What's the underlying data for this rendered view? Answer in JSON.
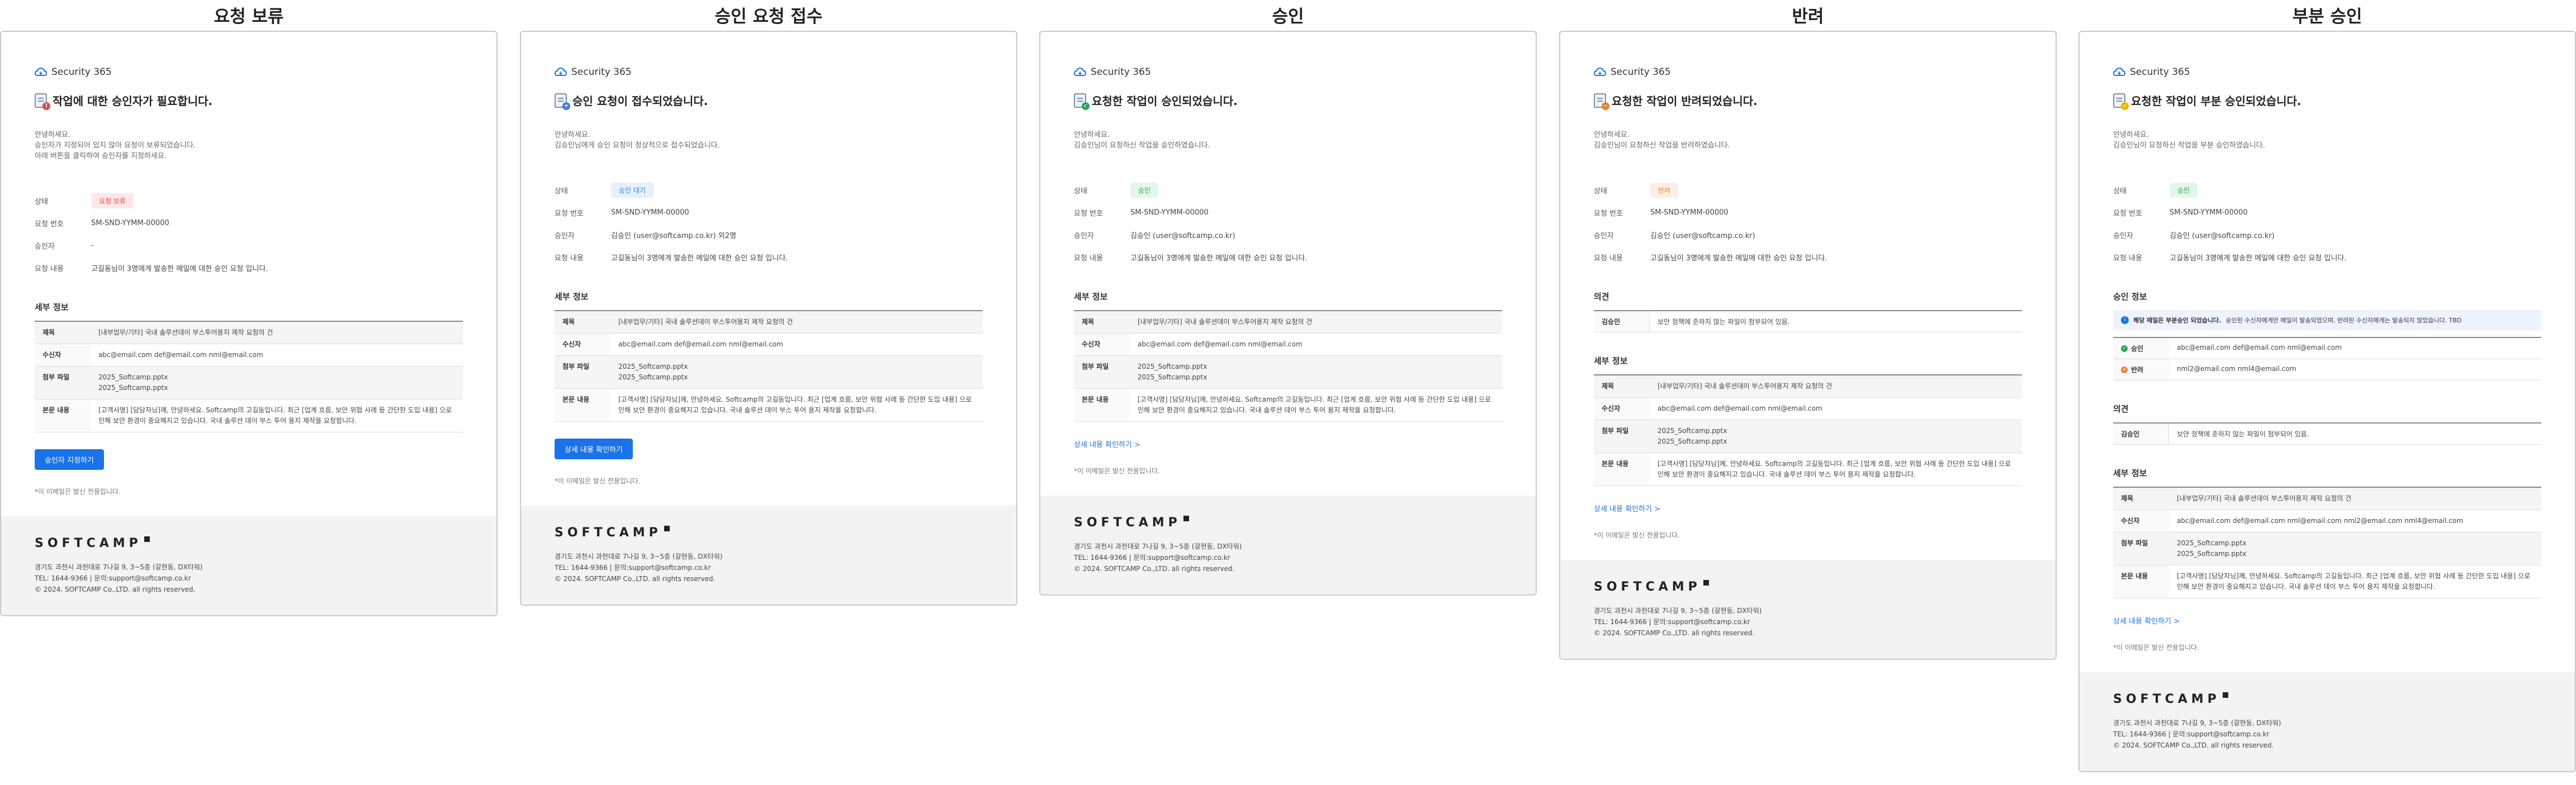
{
  "common": {
    "app_name": "Security 365",
    "greeting": "안녕하세요.",
    "label_status": "상태",
    "label_request_no": "요청 번호",
    "label_approver": "승인자",
    "label_content": "요청 내용",
    "request_no": "SM-SND-YYMM-00000",
    "content": "고길동님이 3명에게 발송한 메일에 대한 승인 요청 입니다.",
    "detail_title": "세부 정보",
    "label_subject": "제목",
    "subject": "[내부업무/기타] 국내 솔루션데이 부스투어용지 제작 요청의 건",
    "label_recipient": "수신자",
    "recipients": "abc@email.com   def@email.com   nml@email.com",
    "label_attachment": "첨부 파일",
    "attachment_1": "2025_Softcamp.pptx",
    "attachment_2": "2025_Softcamp.pptx",
    "label_body": "본문 내용",
    "body_text": "[고객사명] [담당자님]께, 안녕하세요. Softcamp의 고길동입니다. 최근 [업계 흐름, 보안 위협 사례 등 간단한 도입 내용] 으로 인해 보안 환경이 중요해지고 있습니다. 국내 솔루션 데이 부스 투어 용지 제작을 요청합니다.",
    "detail_link": "상세 내용 확인하기 >",
    "notice": "*이 이메일은 발신 전용입니다.",
    "opinion_title": "의견",
    "opinion_name": "김승인",
    "opinion_text": "보안 정책에 준하지 않는 파일이 첨부되어 있음.",
    "footer": {
      "brand": "SOFTCAMP",
      "address": "경기도 과천시 과천대로 7나길 9, 3~5층 (갈현동, DX타워)",
      "contact": "TEL: 1644-9366 | 문의:support@softcamp.co.kr",
      "copyright": "© 2024. SOFTCAMP Co.,LTD. all rights reserved."
    }
  },
  "hold": {
    "column_title": "요청 보류",
    "headline": "작업에 대한 승인자가 필요합니다.",
    "greeting_2": "승인자가 지정되어 있지 않아 요청이 보류되었습니다.",
    "greeting_3": "아래 버튼을 클릭하여 승인자를 지정하세요.",
    "status": "요청 보류",
    "approver": "-",
    "button": "승인자 지정하기"
  },
  "received": {
    "column_title": "승인 요청 접수",
    "headline": "승인 요청이 접수되었습니다.",
    "greeting_2": "김승인님에게 승인 요청이 정상적으로 접수되었습니다.",
    "status": "승인 대기",
    "approver": "김승인 (user@softcamp.co.kr) 외2명",
    "button": "상세 내용 확인하기"
  },
  "approved": {
    "column_title": "승인",
    "headline": "요청한 작업이 승인되었습니다.",
    "greeting_2": "김승인님이 요청하신 작업을 승인하였습니다.",
    "status": "승인",
    "approver": "김승인 (user@softcamp.co.kr)"
  },
  "rejected": {
    "column_title": "반려",
    "headline": "요청한 작업이 반려되었습니다.",
    "greeting_2": "김승인님이 요청하신 작업을 반려하였습니다.",
    "status": "반려",
    "approver": "김승인 (user@softcamp.co.kr)"
  },
  "partial": {
    "column_title": "부분 승인",
    "headline": "요청한 작업이 부분 승인되었습니다.",
    "greeting_2": "김승인님이 요청하신 작업을 부분 승인하였습니다.",
    "status": "승인",
    "approver": "김승인 (user@softcamp.co.kr)",
    "approval_title": "승인 정보",
    "info_bold": "해당 메일은 부분승인 되었습니다.",
    "info_text": "승인된 수신자에게만 메일이 발송되었으며, 반려된 수신자에게는 발송되지 않았습니다. TBD",
    "approve_label": "승인",
    "approve_list": "abc@email.com   def@email.com   nml@email.com",
    "reject_label": "반려",
    "reject_list": "nml2@email.com   nml4@email.com",
    "recipients": "abc@email.com   def@email.com   nml@email.com   nml2@email.com   nml4@email.com"
  },
  "colors": {
    "hold_bg": "#fde8e8",
    "hold_fg": "#e04848",
    "wait_bg": "#e6f0fc",
    "wait_fg": "#3b7ddd",
    "ok_bg": "#e3f6ea",
    "ok_fg": "#2aa55a",
    "reject_bg": "#fdeee3",
    "reject_fg": "#e8803a",
    "accent": "#1a73e8"
  }
}
